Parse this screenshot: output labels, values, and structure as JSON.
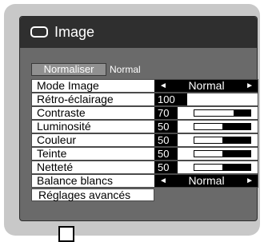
{
  "window": {
    "title": "Image"
  },
  "normaliser": {
    "button_label": "Normaliser",
    "value": "Normal"
  },
  "rows": [
    {
      "label": "Mode Image",
      "kind": "selector",
      "value": "Normal"
    },
    {
      "label": "Rétro-éclairage",
      "kind": "number",
      "value": "100"
    },
    {
      "label": "Contraste",
      "kind": "slider",
      "value": "70",
      "level": 0.3
    },
    {
      "label": "Luminosité",
      "kind": "slider",
      "value": "50",
      "level": 0.5
    },
    {
      "label": "Couleur",
      "kind": "slider",
      "value": "50",
      "level": 0.5
    },
    {
      "label": "Teinte",
      "kind": "slider",
      "value": "50",
      "level": 0.5
    },
    {
      "label": "Netteté",
      "kind": "slider",
      "value": "50",
      "level": 0.5
    },
    {
      "label": "Balance blancs",
      "kind": "selector",
      "value": "Normal"
    }
  ],
  "advanced": {
    "label": "Réglages avancés"
  },
  "icons": {
    "title_icon": "rounded-rectangle-icon",
    "left_arrow": "◄",
    "right_arrow": "►"
  },
  "colors": {
    "panel": "#6a6a6a",
    "titlebar": "#2f2f2f",
    "frame": "#c8c8c8"
  }
}
